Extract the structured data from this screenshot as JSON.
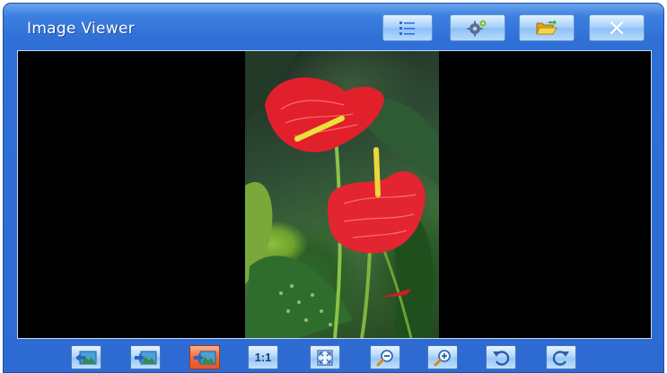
{
  "window": {
    "title": "Image Viewer"
  },
  "titlebar_buttons": [
    {
      "name": "list",
      "icon": "list-icon"
    },
    {
      "name": "settings",
      "icon": "gear-icon"
    },
    {
      "name": "open",
      "icon": "folder-open-icon"
    },
    {
      "name": "close",
      "icon": "close-icon"
    }
  ],
  "toolbar": {
    "buttons": [
      {
        "name": "previous",
        "icon": "previous-image-icon"
      },
      {
        "name": "next",
        "icon": "next-image-icon"
      },
      {
        "name": "fit",
        "icon": "fit-to-window-icon",
        "active": true
      },
      {
        "name": "actual-size",
        "label": "1:1"
      },
      {
        "name": "fullscreen",
        "icon": "fullscreen-icon"
      },
      {
        "name": "zoom-out",
        "icon": "zoom-out-icon"
      },
      {
        "name": "zoom-in",
        "icon": "zoom-in-icon"
      },
      {
        "name": "rotate-left",
        "icon": "rotate-left-icon"
      },
      {
        "name": "rotate-right",
        "icon": "rotate-right-icon"
      }
    ]
  },
  "colors": {
    "frame": "#2f6fd6",
    "viewer_background": "#000000",
    "active_button": "#e4562a"
  }
}
